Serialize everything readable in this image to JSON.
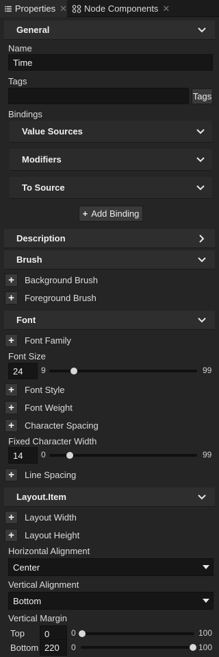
{
  "tabs": [
    {
      "label": "Properties",
      "icon": "list-icon",
      "active": true
    },
    {
      "label": "Node Components",
      "icon": "components-icon",
      "active": false
    }
  ],
  "general": {
    "title": "General",
    "name_label": "Name",
    "name_value": "Time",
    "tags_label": "Tags",
    "tags_value": "",
    "tags_button": "Tags",
    "bindings_label": "Bindings",
    "value_sources": "Value Sources",
    "modifiers": "Modifiers",
    "to_source": "To Source",
    "add_binding": "Add Binding"
  },
  "description": {
    "title": "Description"
  },
  "brush": {
    "title": "Brush",
    "background": "Background Brush",
    "foreground": "Foreground Brush"
  },
  "font": {
    "title": "Font",
    "family": "Font Family",
    "size_label": "Font Size",
    "size_value": "24",
    "size_min": "9",
    "size_max": "99",
    "size_fraction": 0.167,
    "style": "Font Style",
    "weight": "Font Weight",
    "char_spacing": "Character Spacing",
    "fixed_width_label": "Fixed Character Width",
    "fixed_width_value": "14",
    "fixed_width_min": "0",
    "fixed_width_max": "99",
    "fixed_width_fraction": 0.141,
    "line_spacing": "Line Spacing"
  },
  "layout": {
    "title": "Layout.Item",
    "width": "Layout Width",
    "height": "Layout Height",
    "h_align_label": "Horizontal Alignment",
    "h_align_value": "Center",
    "v_align_label": "Vertical Alignment",
    "v_align_value": "Bottom",
    "v_margin_label": "Vertical Margin",
    "top_label": "Top",
    "top_value": "0",
    "top_min": "0",
    "top_max": "100",
    "top_fraction": 0.0,
    "bottom_label": "Bottom",
    "bottom_value": "220",
    "bottom_min": "0",
    "bottom_max": "100",
    "bottom_fraction": 1.0
  },
  "colors": {
    "background": "#252525",
    "section": "#2e2e2e",
    "field": "#161616",
    "text": "#e6e6e6"
  }
}
